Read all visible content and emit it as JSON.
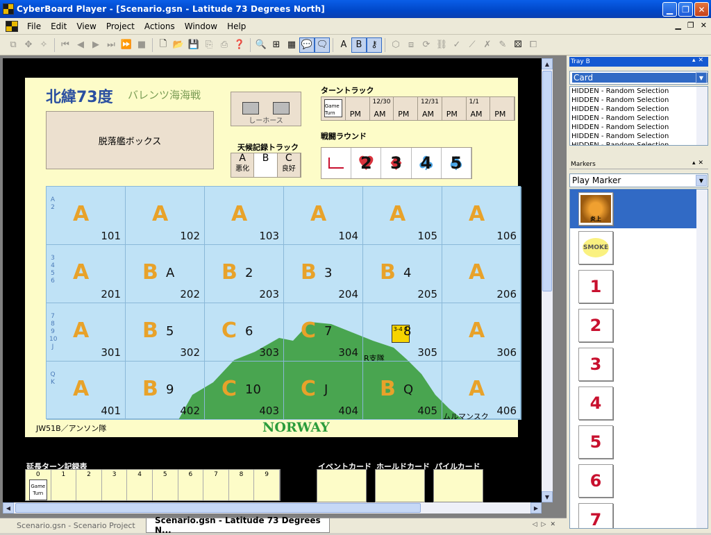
{
  "window": {
    "title": "CyberBoard Player - [Scenario.gsn - Latitude 73 Degrees North]"
  },
  "menu": [
    "File",
    "Edit",
    "View",
    "Project",
    "Actions",
    "Window",
    "Help"
  ],
  "board": {
    "title_jp": "北緯73度",
    "subtitle_jp": "バレンツ海海戦",
    "sunk_box": "脱落艦ボックス",
    "hold_box_text": "しーホース",
    "turn_track_label": "ターントラック",
    "turn_cells": [
      {
        "date": "",
        "period": "Game Turn"
      },
      {
        "date": "",
        "period": "PM"
      },
      {
        "date": "12/30",
        "period": "AM"
      },
      {
        "date": "",
        "period": "PM"
      },
      {
        "date": "12/31",
        "period": "AM"
      },
      {
        "date": "",
        "period": "PM"
      },
      {
        "date": "1/1",
        "period": "AM"
      },
      {
        "date": "",
        "period": "PM"
      }
    ],
    "weather_label": "天候記録トラック",
    "weather_cells": [
      {
        "letter": "A",
        "text": "悪化"
      },
      {
        "letter": "B",
        "text": ""
      },
      {
        "letter": "C",
        "text": "良好"
      }
    ],
    "battle_label": "戦闘ラウンド",
    "battle_cells": [
      "",
      "2",
      "3",
      "4",
      "5"
    ],
    "rows": [
      {
        "label": "A 2",
        "cells": [
          {
            "zone": "A",
            "sub": "",
            "hex": "101"
          },
          {
            "zone": "A",
            "sub": "",
            "hex": "102"
          },
          {
            "zone": "A",
            "sub": "",
            "hex": "103"
          },
          {
            "zone": "A",
            "sub": "",
            "hex": "104"
          },
          {
            "zone": "A",
            "sub": "",
            "hex": "105"
          },
          {
            "zone": "A",
            "sub": "",
            "hex": "106"
          }
        ]
      },
      {
        "label": "3 4 5 6",
        "cells": [
          {
            "zone": "A",
            "sub": "",
            "hex": "201"
          },
          {
            "zone": "B",
            "sub": "A",
            "hex": "202"
          },
          {
            "zone": "B",
            "sub": "2",
            "hex": "203"
          },
          {
            "zone": "B",
            "sub": "3",
            "hex": "204"
          },
          {
            "zone": "B",
            "sub": "4",
            "hex": "205"
          },
          {
            "zone": "A",
            "sub": "",
            "hex": "206"
          }
        ]
      },
      {
        "label": "7 8 9 10 J",
        "cells": [
          {
            "zone": "A",
            "sub": "",
            "hex": "301"
          },
          {
            "zone": "B",
            "sub": "5",
            "hex": "302"
          },
          {
            "zone": "C",
            "sub": "6",
            "hex": "303"
          },
          {
            "zone": "C",
            "sub": "7",
            "hex": "304"
          },
          {
            "zone": "",
            "sub": "8",
            "hex": "305"
          },
          {
            "zone": "A",
            "sub": "",
            "hex": "306"
          }
        ]
      },
      {
        "label": "Q K",
        "cells": [
          {
            "zone": "A",
            "sub": "",
            "hex": "401"
          },
          {
            "zone": "B",
            "sub": "9",
            "hex": "402"
          },
          {
            "zone": "C",
            "sub": "10",
            "hex": "403"
          },
          {
            "zone": "C",
            "sub": "J",
            "hex": "404"
          },
          {
            "zone": "B",
            "sub": "Q",
            "hex": "405"
          },
          {
            "zone": "A",
            "sub": "",
            "hex": "406"
          }
        ]
      }
    ],
    "norway": "NORWAY",
    "convoy": "JW51B／アンソン隊",
    "murmansk": "ムルマンスク",
    "r_force": "R支隊",
    "chit_text": "3-4 4",
    "ext_label": "延長ターン記録表",
    "ext_cells": [
      "0",
      "1",
      "2",
      "3",
      "4",
      "5",
      "6",
      "7",
      "8",
      "9"
    ],
    "game_turn": "Game Turn",
    "event_card": "イベントカード",
    "hold_card": "ホールドカード",
    "pile_card": "パイルカード"
  },
  "tabs": [
    {
      "label": "Scenario.gsn - Scenario Project"
    },
    {
      "label": "Scenario.gsn - Latitude 73 Degrees N..."
    }
  ],
  "tray": {
    "title": "Tray B",
    "selected": "Card",
    "items": [
      "HIDDEN - Random Selection",
      "HIDDEN - Random Selection",
      "HIDDEN - Random Selection",
      "HIDDEN - Random Selection",
      "HIDDEN - Random Selection",
      "HIDDEN - Random Selection",
      "HIDDEN - Random Selection"
    ]
  },
  "markers": {
    "title": "Markers",
    "selected": "Play Marker",
    "items": [
      {
        "kind": "burn",
        "label": "炎上"
      },
      {
        "kind": "smoke",
        "label": "SMOKE"
      },
      {
        "kind": "num",
        "label": "1"
      },
      {
        "kind": "num",
        "label": "2"
      },
      {
        "kind": "num",
        "label": "3"
      },
      {
        "kind": "num",
        "label": "4"
      },
      {
        "kind": "num",
        "label": "5"
      },
      {
        "kind": "num",
        "label": "6"
      },
      {
        "kind": "num",
        "label": "7"
      }
    ]
  },
  "colors": {
    "zone": "#e8a22a",
    "sea": "#bfe2f6",
    "land": "#3c9e3e",
    "board": "#fdfcc8",
    "accent": "#1559d2"
  }
}
